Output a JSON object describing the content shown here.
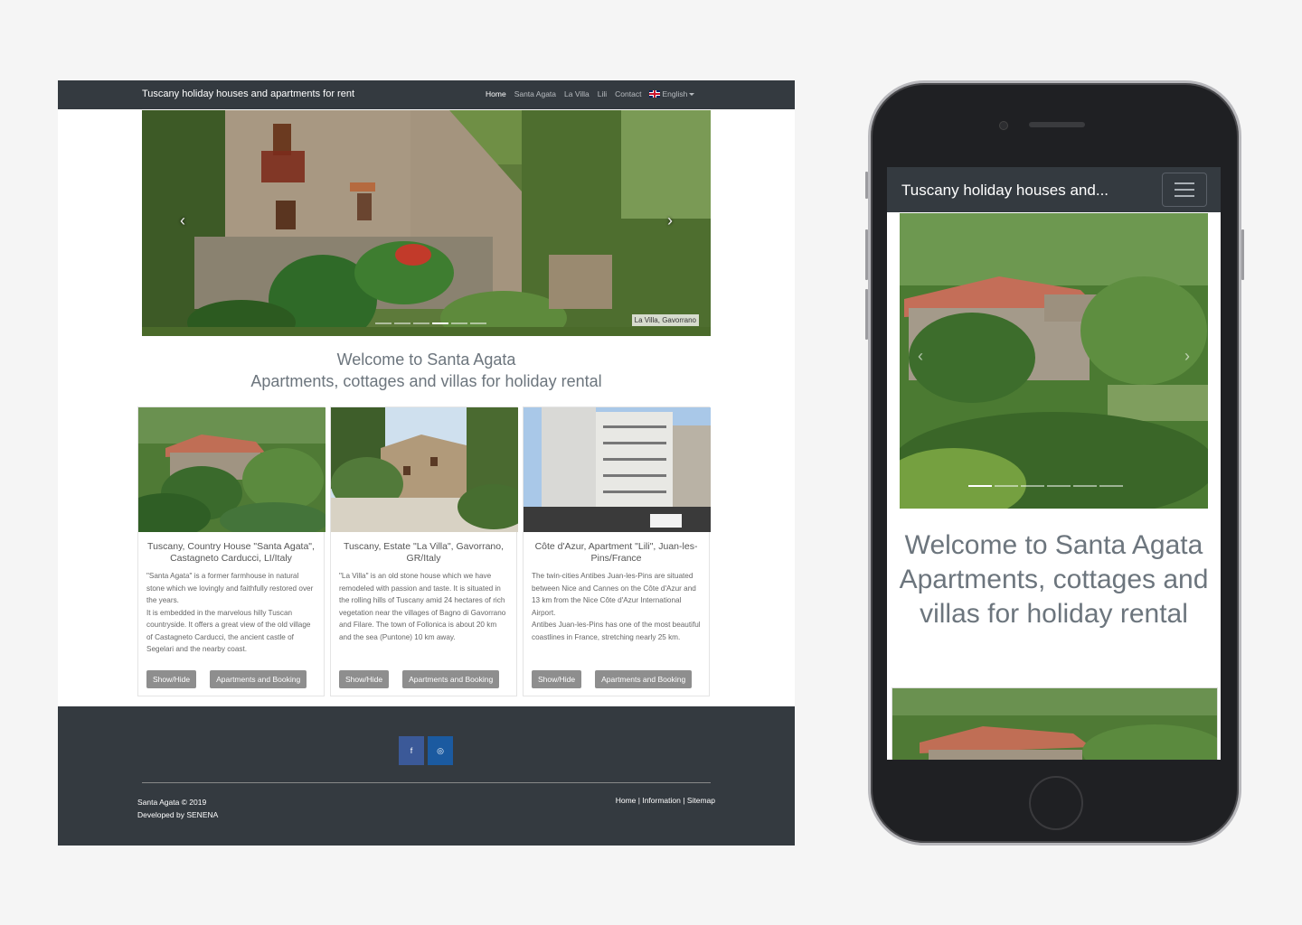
{
  "site": {
    "brand": "Tuscany holiday houses and apartments for rent",
    "brand_short": "Tuscany holiday houses and...",
    "nav": [
      "Home",
      "Santa Agata",
      "La Villa",
      "Lili",
      "Contact"
    ],
    "language": "English"
  },
  "carousel": {
    "caption": "La Villa, Gavorrano",
    "slides": 6,
    "active_index": 3,
    "prev_icon": "chevron-left-icon",
    "next_icon": "chevron-right-icon"
  },
  "welcome": {
    "line1": "Welcome to Santa Agata",
    "line2": "Apartments, cottages and villas for holiday rental"
  },
  "cards": [
    {
      "title": "Tuscany, Country House \"Santa Agata\", Castagneto Carducci, LI/Italy",
      "paragraphs": [
        "\"Santa Agata\" is a former farmhouse in natural stone which we lovingly and faithfully restored over the years.",
        "It is embedded in the marvelous hilly Tuscan countryside. It offers a great view of the old village of Castagneto Carducci, the ancient castle of Segelari and the nearby coast."
      ],
      "btn_toggle": "Show/Hide",
      "btn_booking": "Apartments and Booking"
    },
    {
      "title": "Tuscany, Estate \"La Villa\", Gavorrano, GR/Italy",
      "paragraphs": [
        "\"La Villa\" is an old stone house which we have remodeled with passion and taste. It is situated in the rolling hills of Tuscany amid 24 hectares of rich vegetation near the villages of Bagno di Gavorrano and Filare. The town of Follonica is about 20 km and the sea (Puntone) 10 km away."
      ],
      "btn_toggle": "Show/Hide",
      "btn_booking": "Apartments and Booking"
    },
    {
      "title": "Côte d'Azur, Apartment \"Lili\", Juan-les-Pins/France",
      "paragraphs": [
        "The twin-cities Antibes Juan-les-Pins are situated between Nice and Cannes on the Côte d'Azur and 13 km from the Nice Côte d'Azur International Airport.",
        "Antibes Juan-les-Pins has one of the most beautiful coastlines in France, stretching nearly 25 km."
      ],
      "btn_toggle": "Show/Hide",
      "btn_booking": "Apartments and Booking"
    }
  ],
  "footer": {
    "social": [
      {
        "icon": "facebook-icon",
        "glyph": "f",
        "color": "#3b5998"
      },
      {
        "icon": "instagram-icon",
        "glyph": "◎",
        "color": "#1b5aa0"
      }
    ],
    "copyright": "Santa Agata © 2019",
    "developer": "Developed by SENENA",
    "links": [
      "Home",
      "Information",
      "Sitemap"
    ],
    "separator": " | "
  },
  "colors": {
    "navbar": "#343a40",
    "button": "#8e8e8e",
    "text_muted": "#6c757d"
  }
}
